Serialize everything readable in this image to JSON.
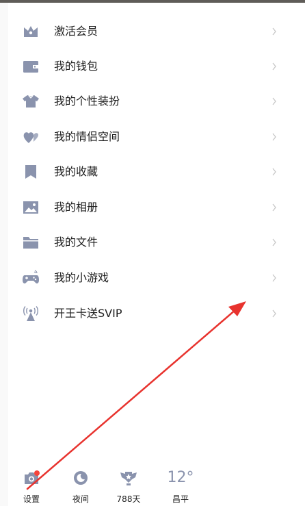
{
  "menu": {
    "items": [
      {
        "label": "激活会员",
        "icon": "crown-icon"
      },
      {
        "label": "我的钱包",
        "icon": "wallet-icon"
      },
      {
        "label": "我的个性装扮",
        "icon": "shirt-icon"
      },
      {
        "label": "我的情侣空间",
        "icon": "hearts-icon"
      },
      {
        "label": "我的收藏",
        "icon": "bookmark-icon"
      },
      {
        "label": "我的相册",
        "icon": "photo-icon"
      },
      {
        "label": "我的文件",
        "icon": "folder-icon"
      },
      {
        "label": "我的小游戏",
        "icon": "gamepad-icon"
      },
      {
        "label": "开王卡送SVIP",
        "icon": "signal-tower-icon"
      }
    ]
  },
  "bottom_bar": {
    "settings_label": "设置",
    "night_label": "夜间",
    "days_label": "788天",
    "temperature": "12°",
    "city": "昌平"
  },
  "colors": {
    "icon": "#8a93ad",
    "badge": "#f5443b",
    "annotation_arrow": "#e8332e",
    "text": "#1f1f1f"
  }
}
